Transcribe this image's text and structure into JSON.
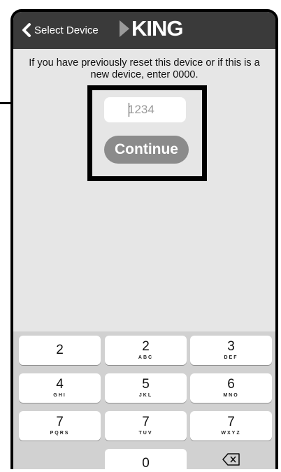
{
  "nav": {
    "back_label": "Select Device",
    "brand": "KING"
  },
  "instructions": "If you have previously reset this device or if this is a new device, enter 0000.",
  "pin": {
    "placeholder": "1234",
    "value": ""
  },
  "continue_label": "Continue",
  "keypad": {
    "rows": [
      [
        {
          "digit": "2",
          "letters": ""
        },
        {
          "digit": "2",
          "letters": "ABC"
        },
        {
          "digit": "3",
          "letters": "DEF"
        }
      ],
      [
        {
          "digit": "4",
          "letters": "GHI"
        },
        {
          "digit": "5",
          "letters": "JKL"
        },
        {
          "digit": "6",
          "letters": "MNO"
        }
      ],
      [
        {
          "digit": "7",
          "letters": "PQRS"
        },
        {
          "digit": "7",
          "letters": "TUV"
        },
        {
          "digit": "7",
          "letters": "WXYZ"
        }
      ],
      [
        {
          "digit": "0",
          "letters": ""
        }
      ]
    ],
    "delete_icon": "backspace-icon"
  },
  "colors": {
    "nav_bg": "#3a3a3a",
    "screen_bg": "#e6e6e6",
    "button_bg": "#8b8b8b",
    "keyboard_bg": "#d1d1d1"
  }
}
